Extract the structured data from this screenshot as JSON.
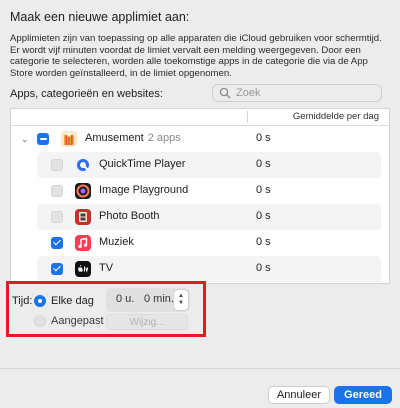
{
  "dialog": {
    "title": "Maak een nieuwe applimiet aan:",
    "description": "Applimieten zijn van toepassing op alle apparaten die iCloud gebruiken voor schermtijd. Er wordt vijf minuten voordat de limiet vervalt een melding weergegeven. Door een categorie te selecteren, worden alle toekomstige apps in de categorie die via de App Store worden geïnstalleerd, in de limiet opgenomen."
  },
  "list": {
    "label": "Apps, categorieën en websites:",
    "search_placeholder": "Zoek",
    "column_header": "Gemiddelde per dag",
    "category": {
      "name": "Amusement",
      "count": "2 apps",
      "time": "0 s",
      "checked": "mixed"
    },
    "apps": [
      {
        "name": "QuickTime Player",
        "time": "0 s",
        "checked": false,
        "icon": "quicktime-icon"
      },
      {
        "name": "Image Playground",
        "time": "0 s",
        "checked": false,
        "icon": "image-playground-icon"
      },
      {
        "name": "Photo Booth",
        "time": "0 s",
        "checked": false,
        "icon": "photo-booth-icon"
      },
      {
        "name": "Muziek",
        "time": "0 s",
        "checked": true,
        "icon": "music-icon"
      },
      {
        "name": "TV",
        "time": "0 s",
        "checked": true,
        "icon": "tv-icon"
      }
    ]
  },
  "time": {
    "label": "Tijd:",
    "options": [
      {
        "label": "Elke dag",
        "selected": true
      },
      {
        "label": "Aangepast",
        "selected": false
      }
    ],
    "hours": "0 u.",
    "minutes": "0 min.",
    "edit_label": "Wijzig..."
  },
  "footer": {
    "cancel_label": "Annuleer",
    "done_label": "Gereed"
  },
  "colors": {
    "accent": "#1a73e8",
    "highlight_box": "#e01b24"
  }
}
